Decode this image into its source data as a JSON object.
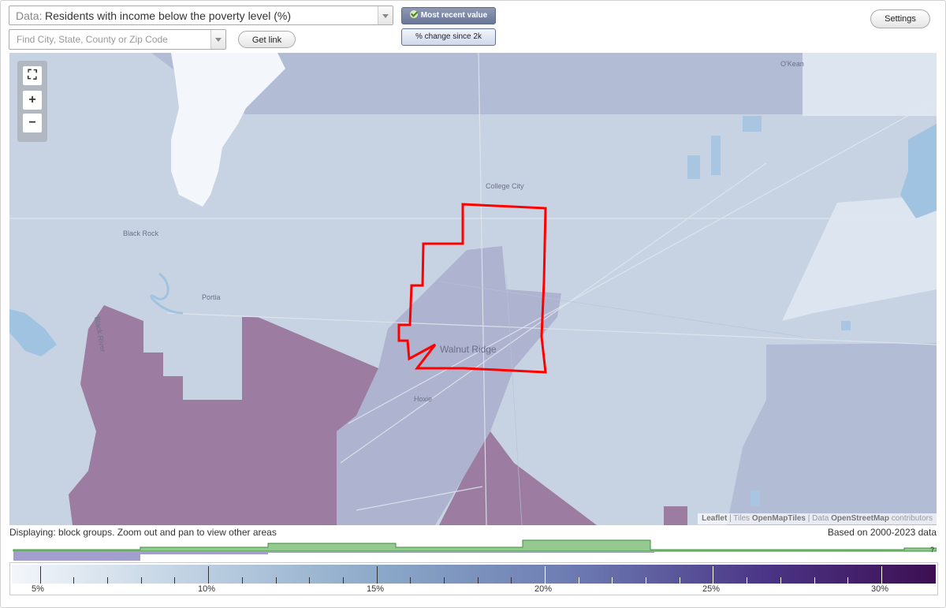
{
  "controls": {
    "data_prefix": "Data:",
    "data_value": "Residents with income below the poverty level (%)",
    "search_placeholder": "Find City, State, County or Zip Code",
    "get_link": "Get link",
    "most_recent": "Most recent value",
    "pct_change": "% change since 2k",
    "settings": "Settings"
  },
  "map": {
    "places": {
      "okean": "O'Kean",
      "college_city": "College City",
      "black_rock": "Black Rock",
      "portia": "Portia",
      "black_river": "Black River",
      "walnut_ridge": "Walnut Ridge",
      "hoxie": "Hoxie"
    },
    "zoom": {
      "fit": "⛶",
      "in": "+",
      "out": "−"
    },
    "attribution": {
      "leaflet": "Leaflet",
      "tiles_prefix": "| Tiles",
      "tiles": "OpenMapTiles",
      "data_prefix": "| Data",
      "data": "OpenStreetMap",
      "suffix": "contributors"
    },
    "colors": {
      "base": "#c7d3e3",
      "light": "#e3ebf3",
      "mid": "#aeb3cf",
      "dark": "#9c7ca0",
      "water": "#9fc3e0",
      "highlight": "#ff0000"
    }
  },
  "status": {
    "left": "Displaying: block groups. Zoom out and pan to view other areas",
    "right": "Based on 2000-2023 data"
  },
  "legend": {
    "labels": [
      "5%",
      "10%",
      "15%",
      "20%",
      "25%",
      "30%"
    ],
    "question": "?"
  }
}
